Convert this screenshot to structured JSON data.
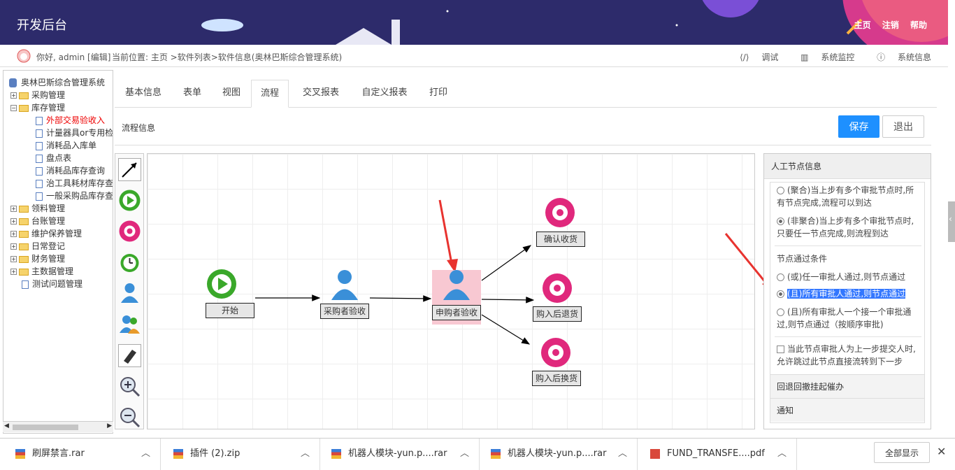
{
  "header": {
    "title": "开发后台",
    "links": [
      "主页",
      "注销",
      "帮助"
    ]
  },
  "subbar": {
    "greeting": "你好, admin [编辑]",
    "breadcrumb": "当前位置: 主页 >软件列表>软件信息(奥林巴斯综合管理系统)",
    "tools": [
      "调试",
      "系统监控",
      "系统信息"
    ]
  },
  "tree": {
    "root": "奥林巴斯综合管理系统",
    "items": [
      "采购管理",
      "库存管理",
      "外部交易验收入",
      "计量器具or专用检",
      "消耗品入库单",
      "盘点表",
      "消耗品库存查询",
      "治工具耗材库存查",
      "一般采购品库存查",
      "领料管理",
      "台账管理",
      "维护保养管理",
      "日常登记",
      "财务管理",
      "主数据管理",
      "测试问题管理"
    ]
  },
  "tabs": [
    "基本信息",
    "表单",
    "视图",
    "流程",
    "交叉报表",
    "自定义报表",
    "打印"
  ],
  "active_tab": "流程",
  "flow_info_label": "流程信息",
  "buttons": {
    "save": "保存",
    "exit": "退出"
  },
  "palette_icons": [
    "arrow-icon",
    "start-node-icon",
    "end-node-icon",
    "timer-node-icon",
    "user-node-icon",
    "multi-user-node-icon",
    "eraser-icon",
    "zoom-in-icon",
    "zoom-out-icon"
  ],
  "flow_nodes": {
    "start": "开始",
    "purchaser": "采购者验收",
    "requester": "申购者验收",
    "confirm": "确认收货",
    "return": "购入后退货",
    "exchange": "购入后换货"
  },
  "panel": {
    "title": "人工节点信息",
    "opt_join": "(聚合)当上步有多个审批节点时,所有节点完成,流程可以到达",
    "opt_nonjoin": "(非聚合)当上步有多个审批节点时,只要任一节点完成,则流程到达",
    "pass_cond_title": "节点通过条件",
    "cond_or": "(或)任一审批人通过,则节点通过",
    "cond_and": "(且)所有审批人通过,则节点通过",
    "cond_seq": "(且)所有审批人一个接一个审批通过,则节点通过（按顺序审批)",
    "skip_label": "当此节点审批人为上一步提交人时,允许跳过此节点直接流转到下一步",
    "section_rollback": "回退回撤挂起催办",
    "section_notify": "通知"
  },
  "downloads": [
    "刷屏禁言.rar",
    "插件 (2).zip",
    "机器人模块-yun.p....rar",
    "机器人模块-yun.p....rar",
    "FUND_TRANSFE....pdf"
  ],
  "show_all": "全部显示"
}
